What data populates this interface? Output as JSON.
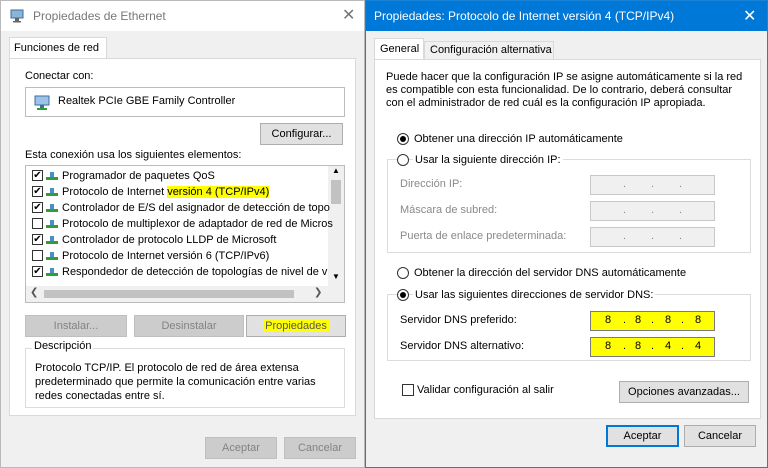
{
  "left_window": {
    "title": "Propiedades de Ethernet",
    "tab": "Funciones de red",
    "connect_using_label": "Conectar con:",
    "adapter_name": "Realtek PCIe GBE Family Controller",
    "configure_button": "Configurar...",
    "items_label": "Esta conexión usa los siguientes elementos:",
    "items": [
      {
        "label": "Programador de paquetes QoS",
        "checked": true,
        "highlight": ""
      },
      {
        "label": "Protocolo de Internet ",
        "checked": true,
        "highlight": "versión 4 (TCP/IPv4)"
      },
      {
        "label": "Controlador de E/S del asignador de detección de topo",
        "checked": true,
        "highlight": ""
      },
      {
        "label": "Protocolo de multiplexor de adaptador de red de Micros",
        "checked": false,
        "highlight": ""
      },
      {
        "label": "Controlador de protocolo LLDP de Microsoft",
        "checked": true,
        "highlight": ""
      },
      {
        "label": "Protocolo de Internet versión 6 (TCP/IPv6)",
        "checked": false,
        "highlight": ""
      },
      {
        "label": "Respondedor de detección de topologías de nivel de v",
        "checked": true,
        "highlight": ""
      }
    ],
    "install_button": "Instalar...",
    "uninstall_button": "Desinstalar",
    "properties_button": "Propiedades",
    "description_group": "Descripción",
    "description_text": "Protocolo TCP/IP. El protocolo de red de área extensa predeterminado que permite la comunicación entre varias redes conectadas entre sí.",
    "accept_button": "Aceptar",
    "cancel_button": "Cancelar"
  },
  "right_window": {
    "title": "Propiedades: Protocolo de Internet versión 4 (TCP/IPv4)",
    "tabs": [
      "General",
      "Configuración alternativa"
    ],
    "intro_text": "Puede hacer que la configuración IP se asigne automáticamente si la red es compatible con esta funcionalidad. De lo contrario, deberá consultar con el administrador de red cuál es la configuración IP apropiada.",
    "ip_auto_label": "Obtener una dirección IP automáticamente",
    "ip_manual_label": "Usar la siguiente dirección IP:",
    "ip_address_label": "Dirección IP:",
    "subnet_label": "Máscara de subred:",
    "gateway_label": "Puerta de enlace predeterminada:",
    "dns_auto_label": "Obtener la dirección del servidor DNS automáticamente",
    "dns_manual_label": "Usar las siguientes direcciones de servidor DNS:",
    "preferred_dns_label": "Servidor DNS preferido:",
    "preferred_dns": [
      "8",
      "8",
      "8",
      "8"
    ],
    "alternate_dns_label": "Servidor DNS alternativo:",
    "alternate_dns": [
      "8",
      "8",
      "4",
      "4"
    ],
    "validate_label": "Validar configuración al salir",
    "advanced_button": "Opciones avanzadas...",
    "accept_button": "Aceptar",
    "cancel_button": "Cancelar"
  },
  "colors": {
    "highlight": "#ffff00",
    "accent": "#0078d7",
    "check_green": "#2e9e3a"
  }
}
